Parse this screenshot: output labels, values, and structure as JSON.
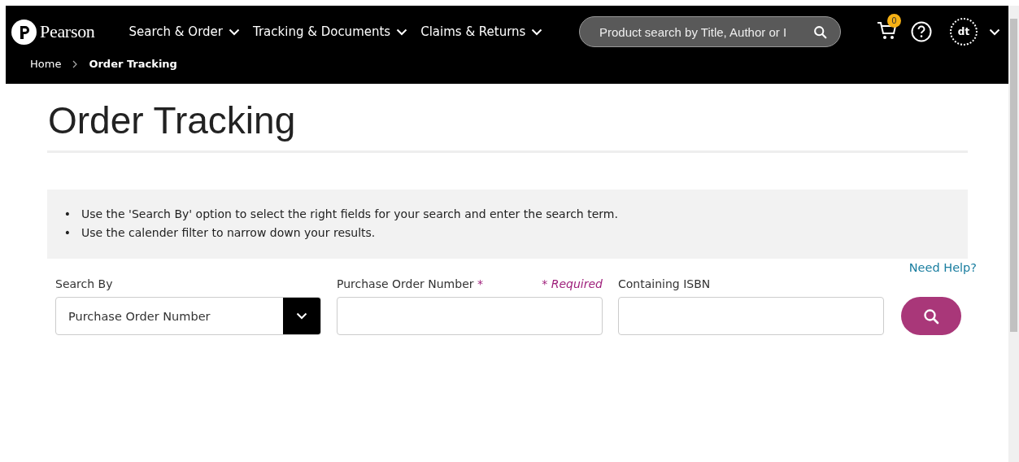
{
  "header": {
    "logo": "Pearson",
    "nav": [
      {
        "label": "Search & Order"
      },
      {
        "label": "Tracking & Documents"
      },
      {
        "label": "Claims & Returns"
      }
    ],
    "search": {
      "placeholder": "Product search by Title, Author or I"
    },
    "cart_count": "0",
    "avatar": "dt"
  },
  "breadcrumb": [
    {
      "label": "Home",
      "selected": false
    },
    {
      "label": "Order Tracking",
      "selected": true
    }
  ],
  "page_title": "Order Tracking",
  "instructions": [
    {
      "bullet": "•",
      "text": "Use the 'Search By' option to select the right fields for your search and enter the search term."
    },
    {
      "bullet": "•",
      "text": "Use the calender filter to narrow down your results."
    }
  ],
  "help_link": "Need Help?",
  "form": {
    "search_by": {
      "label": "Search By",
      "value": "Purchase Order Number"
    },
    "po_number": {
      "label": "Purchase Order Number",
      "required_mark": "*",
      "required_note": "* Required"
    },
    "isbn": {
      "label": "Containing ISBN"
    }
  }
}
